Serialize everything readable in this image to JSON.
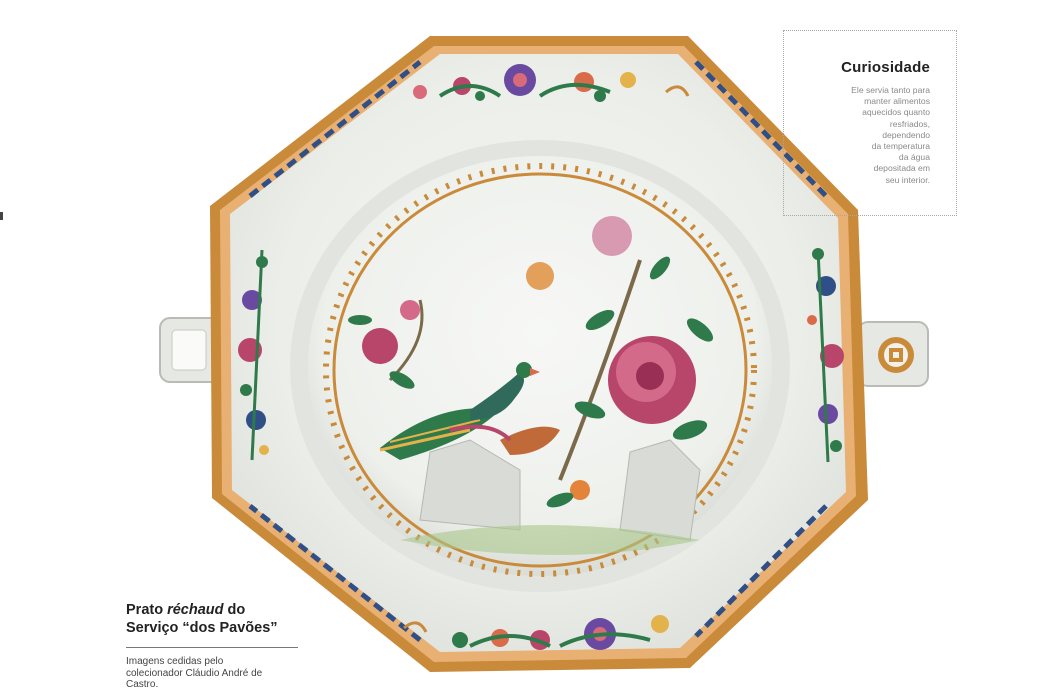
{
  "photo": {
    "subject": "porcelain octagonal rechaud dish",
    "colors": {
      "porcelain": "#eef0ec",
      "gold": "#c98a3a",
      "blue": "#2f4f86",
      "peony": "#b8456a",
      "green": "#2f7a4a"
    }
  },
  "sidebox": {
    "title": "Curiosidade",
    "lines": [
      "Ele servia tanto para",
      "manter alimentos",
      "aquecidos quanto",
      "resfriados,",
      "dependendo",
      "da temperatura",
      "da água",
      "depositada em",
      "seu interior."
    ]
  },
  "caption": {
    "title_part1": "Prato ",
    "title_italic": "réchaud",
    "title_part2": " do",
    "title_line2": "Serviço “dos Pavões”",
    "credit": "Imagens cedidas pelo colecionador Cláudio André de Castro."
  }
}
